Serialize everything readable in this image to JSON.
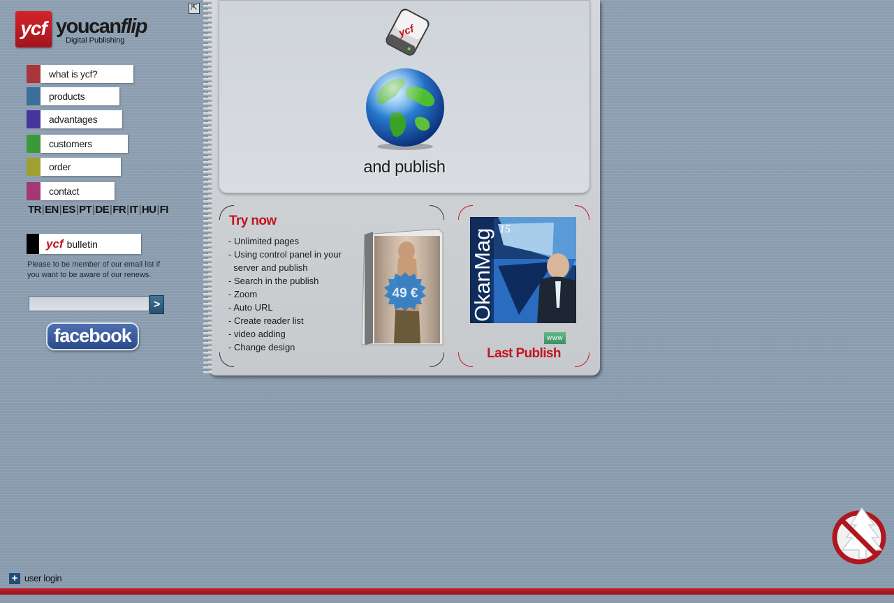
{
  "logo": {
    "mark": "ycf",
    "name_you": "you",
    "name_can": "can",
    "name_flip": "flip",
    "subtitle": "Digital Publishing"
  },
  "nav": {
    "items": [
      {
        "label": "what is ycf?",
        "color": "#a8363a"
      },
      {
        "label": "products",
        "color": "#3b6e98"
      },
      {
        "label": "advantages",
        "color": "#44349c"
      },
      {
        "label": "customers",
        "color": "#3a9a3a"
      },
      {
        "label": "order",
        "color": "#a0a032"
      },
      {
        "label": "contact",
        "color": "#a33873"
      }
    ]
  },
  "languages": [
    "TR",
    "EN",
    "ES",
    "PT",
    "DE",
    "FR",
    "IT",
    "HU",
    "FI"
  ],
  "bulletin": {
    "brand": "ycf",
    "label": "bulletin",
    "text": "Please to be member of our email list if you want to be aware of our renews.",
    "submit": ">"
  },
  "facebook": {
    "label": "facebook"
  },
  "user_login": {
    "icon": "+",
    "label": "user login"
  },
  "hero": {
    "device_label": "ycf",
    "caption": "and publish"
  },
  "try_now": {
    "title": "Try now",
    "features": [
      "- Unlimited pages",
      "- Using control panel in your",
      "  server and publish",
      "- Search in the publish",
      "- Zoom",
      "- Auto URL",
      "- Create reader list",
      "- video adding",
      "- Change design"
    ],
    "price": "49 €"
  },
  "last_publish": {
    "title": "Last Publish",
    "magazine_title": "OkanMag",
    "magazine_issue": "15",
    "www": "www"
  },
  "icons": {
    "expand": "expand-icon",
    "globe": "globe-icon",
    "device": "ycf-device-icon",
    "no_tree": "no-tree-icon",
    "plus": "plus-icon"
  },
  "colors": {
    "brand_red": "#c2161f",
    "footer_red": "#b01c24"
  }
}
